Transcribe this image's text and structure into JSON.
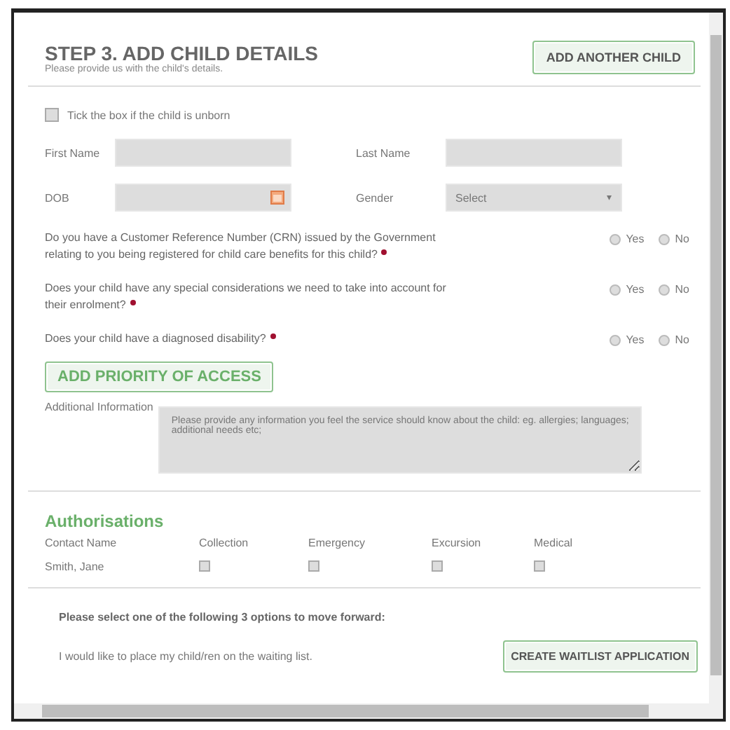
{
  "header": {
    "title": "STEP 3. ADD CHILD DETAILS",
    "subtitle": "Please provide us with the child's details.",
    "button": "ADD ANOTHER CHILD"
  },
  "unborn": {
    "label": "Tick the box if the child is unborn",
    "checked": false
  },
  "first_name": {
    "label": "First Name"
  },
  "last_name": {
    "label": "Last Name"
  },
  "dob": {
    "label": "DOB"
  },
  "gender": {
    "label": "Gender",
    "value": "Select",
    "caret": "▾"
  },
  "questions": [
    {
      "text": "Do you have a Customer Reference Number (CRN) issued by the Government relating to you being registered for child care benefits for this child?",
      "required": true,
      "options": [
        {
          "label": "Yes",
          "selected": false
        },
        {
          "label": "No",
          "selected": false
        }
      ]
    },
    {
      "text": "Does your child have any special considerations we need to take into account for their enrolment?",
      "required": true,
      "options": [
        {
          "label": "Yes",
          "selected": false
        },
        {
          "label": "No",
          "selected": false
        }
      ]
    },
    {
      "text": "Does your child have a diagnosed disability?",
      "required": true,
      "options": [
        {
          "label": "Yes",
          "selected": false
        },
        {
          "label": "No",
          "selected": false
        }
      ]
    }
  ],
  "priority_button": "ADD PRIORITY OF ACCESS",
  "additional_info": {
    "label": "Additional Information",
    "placeholder": "Please provide any information you feel the service should know about the child: eg. allergies; languages; additional needs etc;"
  },
  "authorisations": {
    "title": "Authorisations",
    "columns": [
      "Contact Name",
      "Collection",
      "Emergency",
      "Excursion",
      "Medical"
    ],
    "rows": [
      {
        "name": "Smith, Jane",
        "checks": [
          false,
          false,
          false,
          false
        ]
      }
    ]
  },
  "options_prompt": "Please select one of the following 3 options to move forward:",
  "waitlist": {
    "text": "I would like to place my child/ren on the waiting list.",
    "button": "CREATE WAITLIST APPLICATION"
  }
}
